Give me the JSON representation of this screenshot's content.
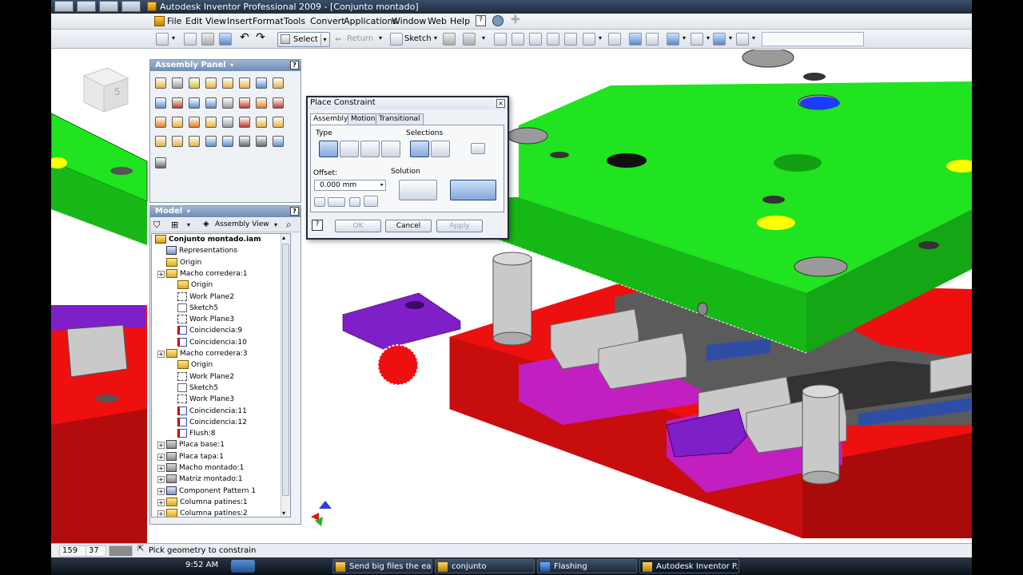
{
  "window": {
    "title": "Autodesk Inventor Professional 2009 - [Conjunto montado]"
  },
  "menu": [
    "File",
    "Edit",
    "View",
    "Insert",
    "Format",
    "Tools",
    "Convert",
    "Applications",
    "Window",
    "Web",
    "Help"
  ],
  "toolbar": {
    "select_label": "Select",
    "return_label": "Return",
    "sketch_label": "Sketch"
  },
  "assembly_panel": {
    "title": "Assembly Panel",
    "viewcube_label": "5"
  },
  "model_panel": {
    "title": "Model",
    "view_mode": "Assembly View",
    "tree": [
      {
        "label": "Conjunto montado.iam",
        "icon": "assembly-doc-icon"
      },
      {
        "label": "Representations",
        "icon": "representations-icon"
      },
      {
        "label": "Origin",
        "icon": "folder-icon"
      },
      {
        "label": "Macho corredera:1",
        "icon": "part-icon"
      },
      {
        "label": "Origin",
        "icon": "folder-icon"
      },
      {
        "label": "Work Plane2",
        "icon": "work-plane-icon"
      },
      {
        "label": "Sketch5",
        "icon": "sketch-icon"
      },
      {
        "label": "Work Plane3",
        "icon": "work-plane-icon"
      },
      {
        "label": "Coincidencia:9",
        "icon": "constraint-icon"
      },
      {
        "label": "Coincidencia:10",
        "icon": "constraint-icon"
      },
      {
        "label": "Macho corredera:3",
        "icon": "part-icon"
      },
      {
        "label": "Origin",
        "icon": "folder-icon"
      },
      {
        "label": "Work Plane2",
        "icon": "work-plane-icon"
      },
      {
        "label": "Sketch5",
        "icon": "sketch-icon"
      },
      {
        "label": "Work Plane3",
        "icon": "work-plane-icon"
      },
      {
        "label": "Coincidencia:11",
        "icon": "constraint-icon"
      },
      {
        "label": "Coincidencia:12",
        "icon": "constraint-icon"
      },
      {
        "label": "Flush:8",
        "icon": "constraint-icon"
      },
      {
        "label": "Placa base:1",
        "icon": "part-gray-icon"
      },
      {
        "label": "Placa tapa:1",
        "icon": "part-gray-icon"
      },
      {
        "label": "Macho montado:1",
        "icon": "subassembly-icon"
      },
      {
        "label": "Matriz montado:1",
        "icon": "subassembly-icon"
      },
      {
        "label": "Component Pattern 1",
        "icon": "pattern-icon"
      },
      {
        "label": "Columna patines:1",
        "icon": "part-icon"
      },
      {
        "label": "Columna patines:2",
        "icon": "part-icon"
      }
    ]
  },
  "dialog": {
    "title": "Place Constraint",
    "tabs": [
      "Assembly",
      "Motion",
      "Transitional"
    ],
    "type_label": "Type",
    "selections_label": "Selections",
    "offset_label": "Offset:",
    "offset_value": "0.000 mm",
    "solution_label": "Solution",
    "ok_label": "OK",
    "cancel_label": "Cancel",
    "apply_label": "Apply"
  },
  "status": {
    "coord_x": "159",
    "coord_y": "37",
    "message": "Pick geometry to constrain"
  },
  "taskbar": {
    "clock": "9:52 AM",
    "tasks": [
      "Send big files the ea...",
      "conjunto",
      "Flashing",
      "Autodesk Inventor P..."
    ]
  },
  "colors": {
    "green_plate": "#1fe41f",
    "red_plate": "#ee0f0f",
    "purple_part": "#7f1fc8",
    "magenta_part": "#c11fc0",
    "gray_part": "#c9c9c9",
    "dark_gray_part": "#5b5b5b",
    "blue_strip": "#2e4ea6",
    "yellow_hole": "#ffff00"
  }
}
